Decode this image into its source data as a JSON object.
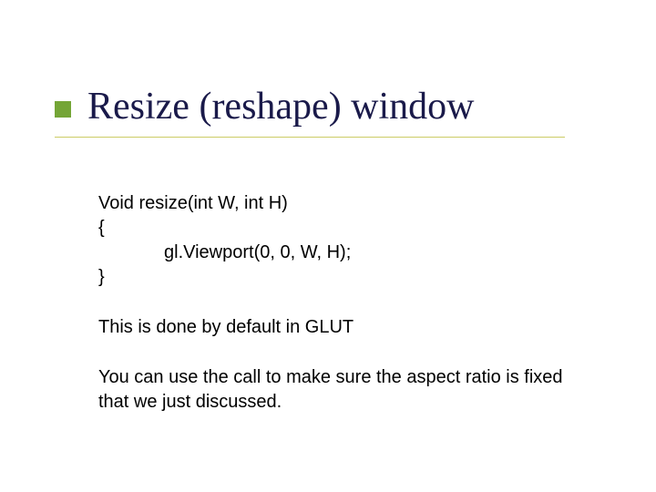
{
  "title": "Resize (reshape) window",
  "code": {
    "l1": "Void resize(int W, int H)",
    "l2": "{",
    "l3": "gl.Viewport(0, 0, W, H);",
    "l4": "}"
  },
  "para1": "This is done by default in GLUT",
  "para2": "You can use the call to make sure the aspect ratio  is fixed that we just discussed."
}
